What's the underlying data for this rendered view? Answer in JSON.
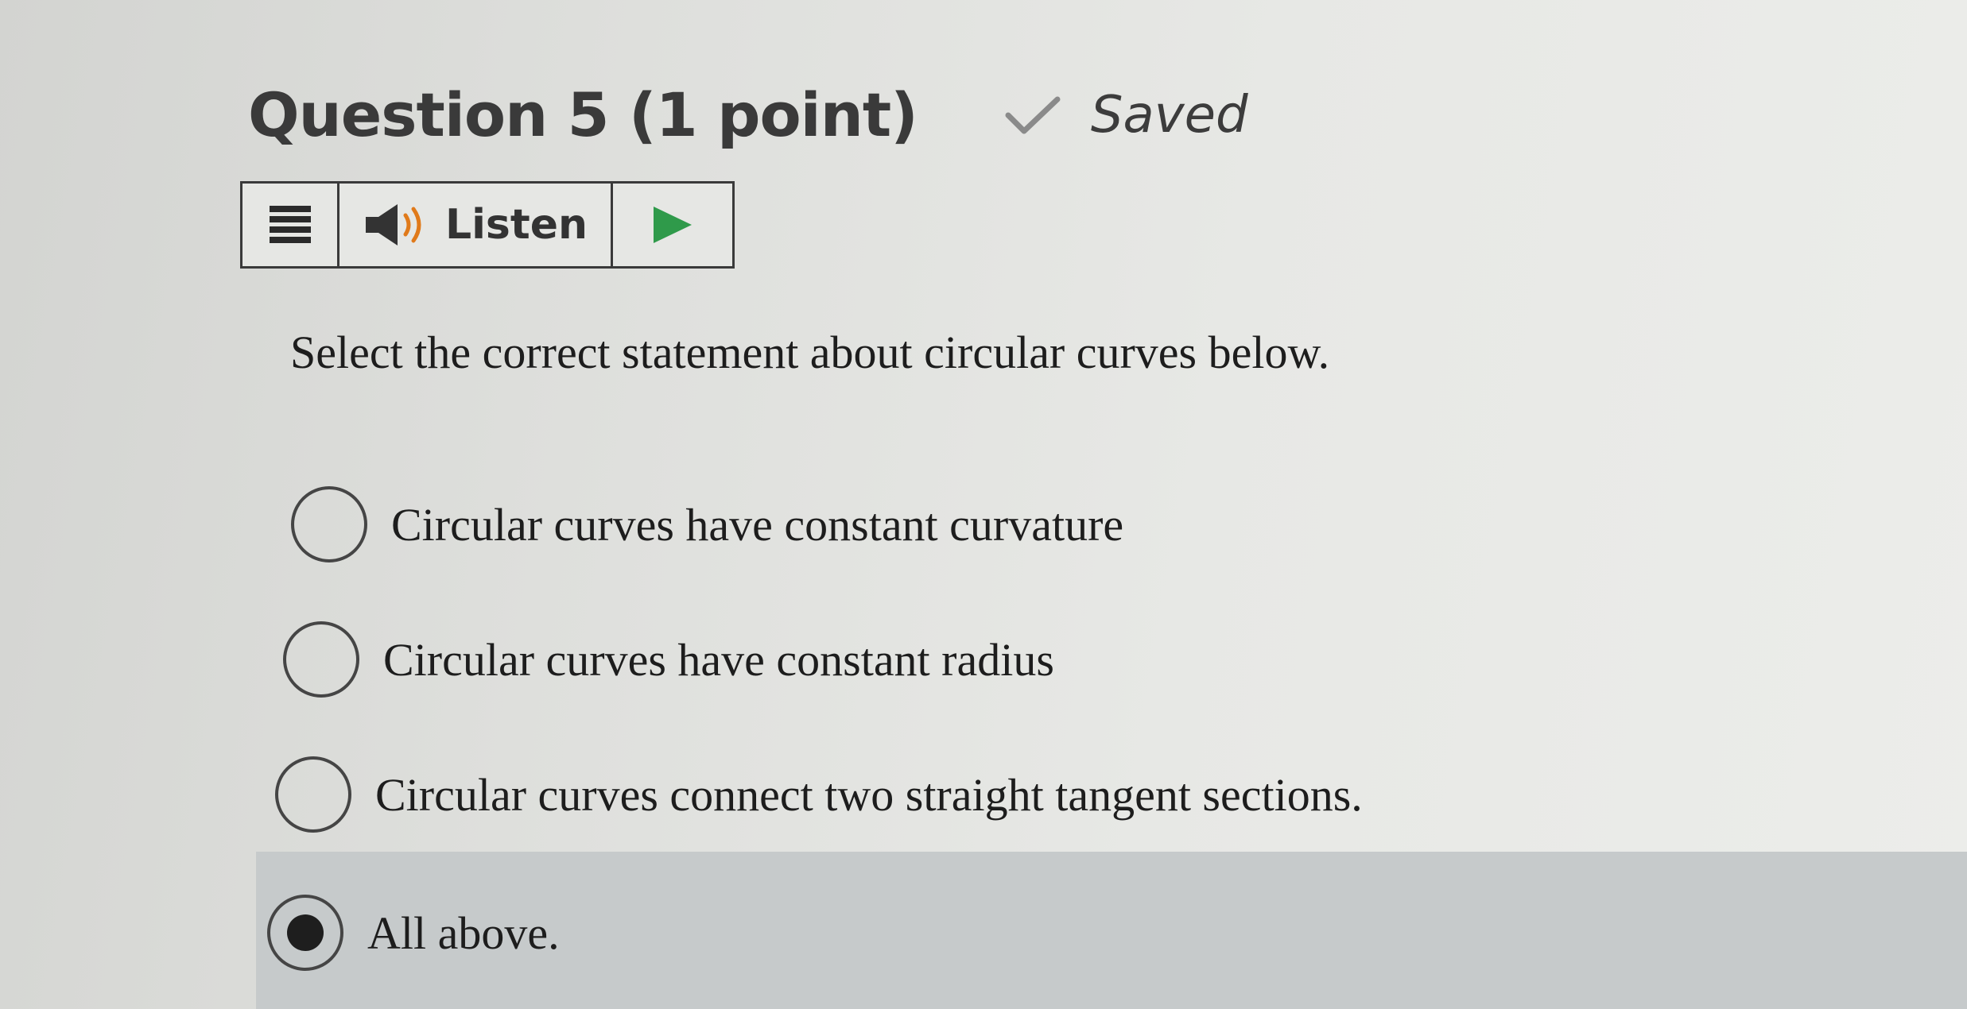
{
  "header": {
    "title": "Question 5 (1 point)",
    "status_icon": "checkmark-icon",
    "status_text": "Saved"
  },
  "listen_toolbar": {
    "menu_icon": "menu-icon",
    "speaker_icon": "speaker-icon",
    "listen_label": "Listen",
    "play_icon": "play-icon"
  },
  "question": {
    "prompt": "Select the correct statement about circular curves below.",
    "options": [
      {
        "label": "Circular curves have constant curvature",
        "selected": false
      },
      {
        "label": "Circular curves have constant radius",
        "selected": false
      },
      {
        "label": "Circular curves connect two straight tangent sections.",
        "selected": false
      },
      {
        "label": "All above.",
        "selected": true
      }
    ]
  },
  "colors": {
    "accent_green": "#2f9a4a",
    "selected_background": "#c6cacb"
  }
}
